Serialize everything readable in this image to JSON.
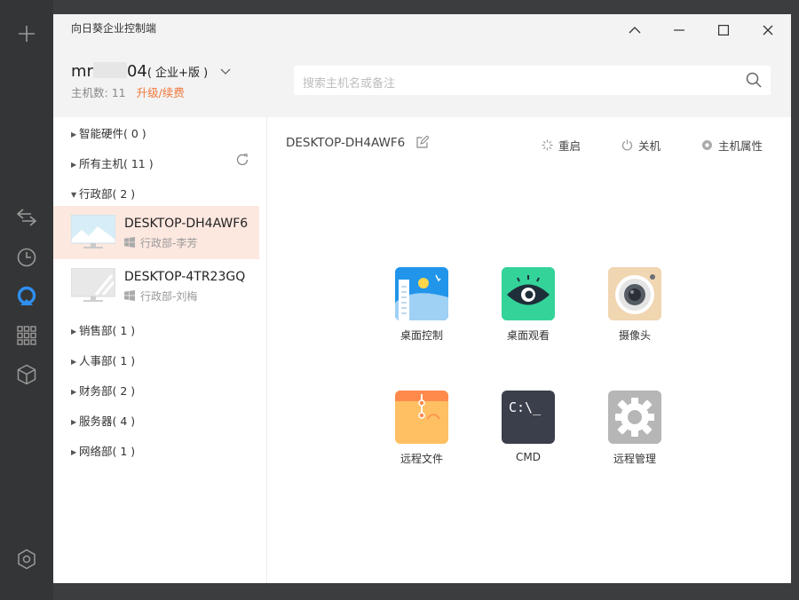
{
  "app": {
    "title": "向日葵企业控制端"
  },
  "account": {
    "name_prefix": "mr",
    "name_suffix": "04",
    "edition": "( 企业+版 )",
    "host_count_label": "主机数:",
    "host_count": "11",
    "upgrade_label": "升级/续费"
  },
  "search": {
    "placeholder": "搜索主机名或备注"
  },
  "sidebar": {
    "groups_top": [
      {
        "label": "智能硬件( 0 )"
      },
      {
        "label": "所有主机( 11 )"
      },
      {
        "label": "行政部( 2 )"
      }
    ],
    "hosts": [
      {
        "name": "DESKTOP-DH4AWF6",
        "meta": "行政部-李芳",
        "selected": true
      },
      {
        "name": "DESKTOP-4TR23GQ",
        "meta": "行政部-刘梅",
        "selected": false
      }
    ],
    "groups_bottom": [
      {
        "label": "销售部( 1 )"
      },
      {
        "label": "人事部( 1 )"
      },
      {
        "label": "财务部( 2 )"
      },
      {
        "label": "服务器( 4 )"
      },
      {
        "label": "网络部( 1 )"
      }
    ]
  },
  "main": {
    "host_title": "DESKTOP-DH4AWF6",
    "actions": {
      "restart": "重启",
      "shutdown": "关机",
      "properties": "主机属性"
    },
    "tiles": [
      {
        "label": "桌面控制",
        "icon": "desktop-control-icon"
      },
      {
        "label": "桌面观看",
        "icon": "desktop-view-icon"
      },
      {
        "label": "摄像头",
        "icon": "camera-icon"
      },
      {
        "label": "远程文件",
        "icon": "remote-file-icon"
      },
      {
        "label": "CMD",
        "icon": "cmd-icon",
        "glyph": "C:\\_"
      },
      {
        "label": "远程管理",
        "icon": "remote-manage-icon"
      }
    ]
  },
  "colors": {
    "accent": "#f0763a",
    "selected_row": "#fde8e0",
    "rail": "#343536"
  }
}
